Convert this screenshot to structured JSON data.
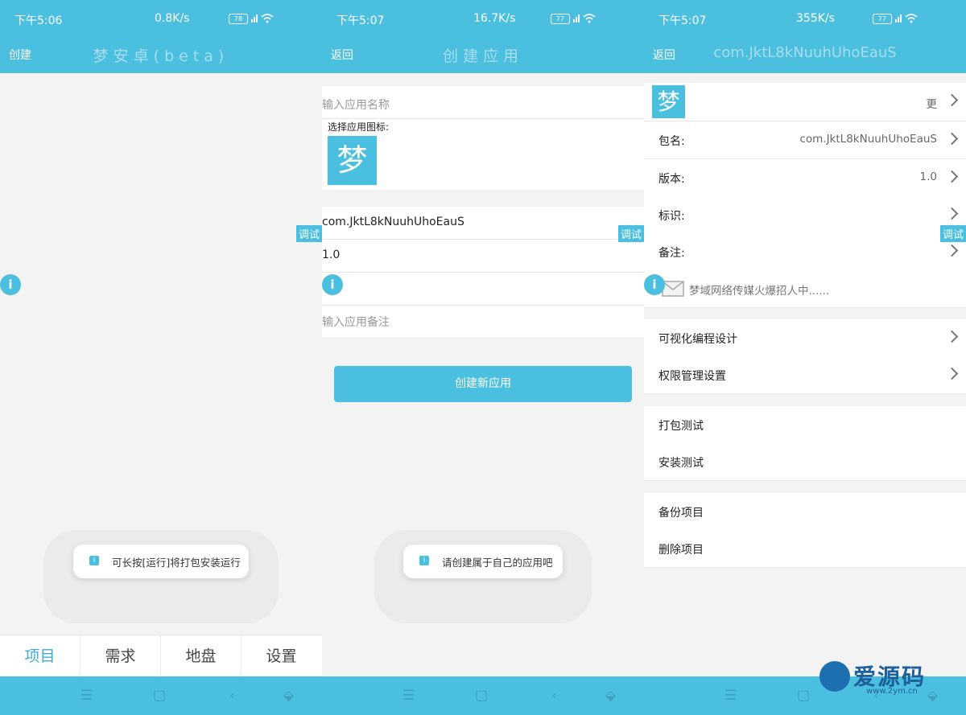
{
  "panel1": {
    "status": {
      "time": "下午5:06",
      "speed": "0.8K/s",
      "battery": "78"
    },
    "appbar": {
      "left": "创建",
      "title": "梦安卓(beta)"
    },
    "debug": "调试",
    "info": "i",
    "toast": "可长按[运行]将打包安装运行",
    "tabs": [
      "项目",
      "需求",
      "地盘",
      "设置"
    ]
  },
  "panel2": {
    "status": {
      "time": "下午5:07",
      "speed": "16.7K/s",
      "battery": "77"
    },
    "appbar": {
      "left": "返回",
      "title": "创建应用"
    },
    "name_placeholder": "输入应用名称",
    "icon_label": "选择应用图标:",
    "logo": "梦",
    "package": "com.JktL8kNuuhUhoEauS",
    "version": "1.0",
    "note_placeholder": "输入应用备注",
    "create_button": "创建新应用",
    "debug": "调试",
    "info": "i",
    "toast": "请创建属于自己的应用吧"
  },
  "panel3": {
    "status": {
      "time": "下午5:07",
      "speed": "355K/s",
      "battery": "77"
    },
    "appbar": {
      "left": "返回",
      "title": "com.JktL8kNuuhUhoEauS"
    },
    "logo": "梦",
    "logo_action": "更",
    "rows": [
      {
        "label": "包名:",
        "value": "com.JktL8kNuuhUhoEauS"
      },
      {
        "label": "版本:",
        "value": "1.0"
      },
      {
        "label": "标识:",
        "value": ""
      },
      {
        "label": "备注:",
        "value": ""
      }
    ],
    "ad": "梦域网络传媒火爆招人中......",
    "settings": [
      "可视化编程设计",
      "权限管理设置"
    ],
    "tests": [
      "打包测试",
      "安装测试"
    ],
    "project": [
      "备份项目",
      "删除项目"
    ],
    "debug": "调试",
    "info": "i"
  },
  "watermark": {
    "name": "爱源码",
    "url": "www.2ym.cn"
  },
  "colors": {
    "accent": "#4bbfe0",
    "background": "#f3f3f3"
  }
}
